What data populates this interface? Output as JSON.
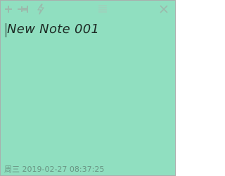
{
  "colors": {
    "note_bg": "#90dfc0",
    "icon": "#9bbaac",
    "text": "#1d2a24",
    "status_text": "#6a9684"
  },
  "toolbar": {
    "icons": [
      "add-icon",
      "pin-icon",
      "lightning-icon",
      "menu-lines-icon",
      "close-icon"
    ]
  },
  "note": {
    "text": "New Note 001"
  },
  "status": {
    "datetime": "周三 2019-02-27 08:37:25"
  }
}
